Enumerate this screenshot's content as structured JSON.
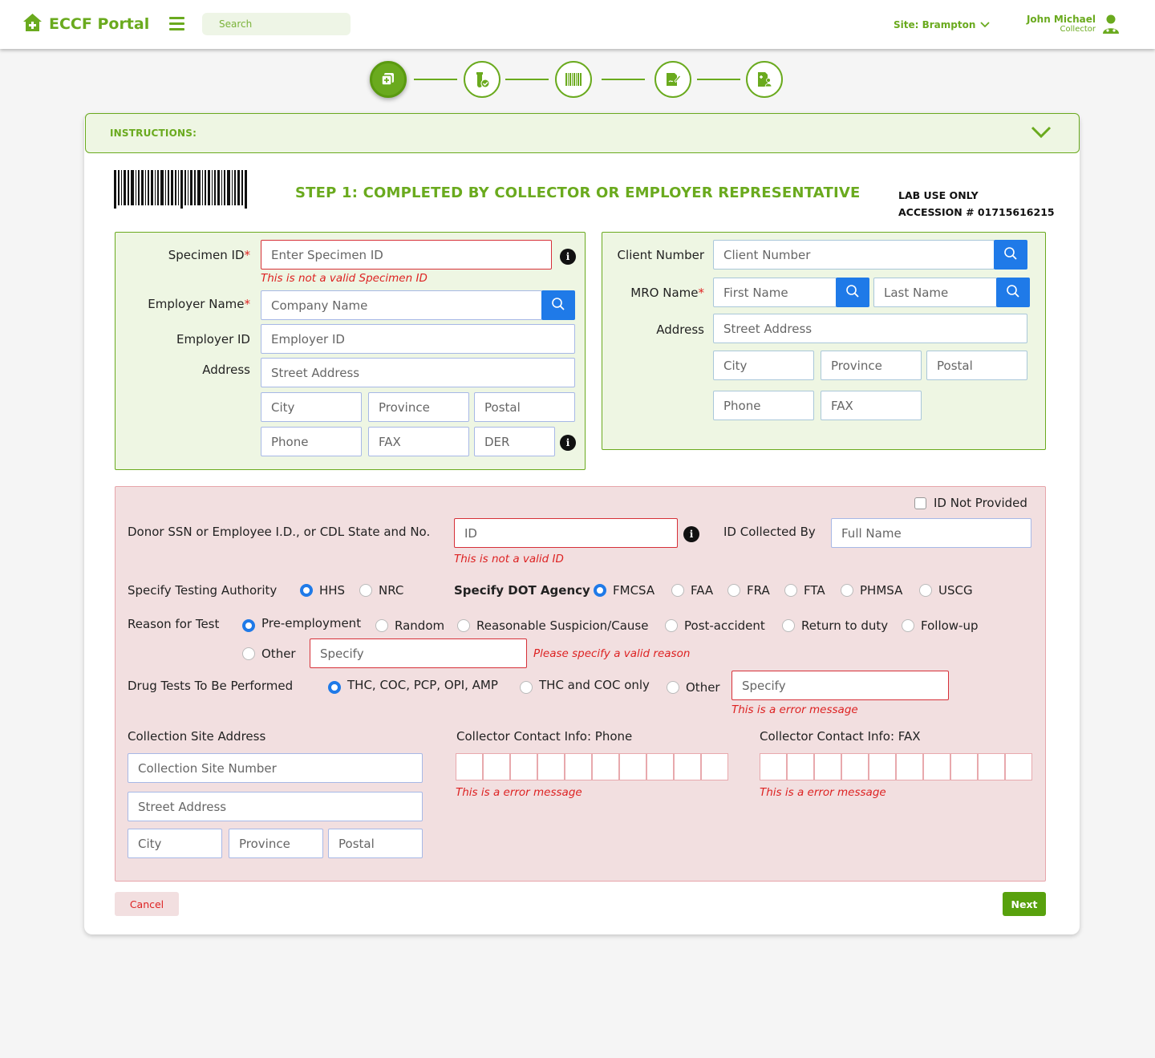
{
  "header": {
    "brand": "ECCF Portal",
    "search_placeholder": "Search",
    "site_label": "Site: Brampton",
    "user_name": "John Michael",
    "user_role": "Collector"
  },
  "stepper": {
    "steps": [
      {
        "icon": "document-add-icon",
        "active": true
      },
      {
        "icon": "specimen-check-icon",
        "active": false
      },
      {
        "icon": "barcode-icon",
        "active": false
      },
      {
        "icon": "signature-edit-icon",
        "active": false
      },
      {
        "icon": "id-card-icon",
        "active": false
      }
    ]
  },
  "instructions": {
    "label": "INSTRUCTIONS:"
  },
  "step_title": "STEP 1: COMPLETED BY COLLECTOR OR EMPLOYER REPRESENTATIVE",
  "lab": {
    "line1": "LAB USE ONLY",
    "line2": "ACCESSION # 01715616215"
  },
  "employer_panel": {
    "specimen_label": "Specimen ID",
    "specimen_placeholder": "Enter Specimen ID",
    "specimen_error": "This is not a valid Specimen ID",
    "employer_name_label": "Employer Name",
    "employer_name_placeholder": "Company Name",
    "employer_id_label": "Employer ID",
    "employer_id_placeholder": "Employer ID",
    "address_label": "Address",
    "street_placeholder": "Street Address",
    "city_placeholder": "City",
    "province_placeholder": "Province",
    "postal_placeholder": "Postal",
    "phone_placeholder": "Phone",
    "fax_placeholder": "FAX",
    "der_placeholder": "DER"
  },
  "mro_panel": {
    "client_label": "Client Number",
    "client_placeholder": "Client Number",
    "mro_label": "MRO Name",
    "first_placeholder": "First Name",
    "last_placeholder": "Last Name",
    "address_label": "Address",
    "street_placeholder": "Street Address",
    "city_placeholder": "City",
    "province_placeholder": "Province",
    "postal_placeholder": "Postal",
    "phone_placeholder": "Phone",
    "fax_placeholder": "FAX"
  },
  "donor_panel": {
    "id_not_provided": "ID Not Provided",
    "donor_label": "Donor SSN or Employee I.D., or CDL State and No.",
    "id_placeholder": "ID",
    "id_error": "This is not a valid  ID",
    "collected_by_label": "ID Collected By",
    "collected_by_placeholder": "Full Name",
    "authority_label": "Specify Testing Authority",
    "authority_options": [
      "HHS",
      "NRC"
    ],
    "authority_selected": "HHS",
    "dot_label": "Specify DOT Agency",
    "dot_options": [
      "FMCSA",
      "FAA",
      "FRA",
      "FTA",
      "PHMSA",
      "USCG"
    ],
    "dot_selected": "FMCSA",
    "reason_label": "Reason for Test",
    "reason_options": [
      "Pre-employment",
      "Random",
      "Reasonable Suspicion/Cause",
      "Post-accident",
      "Return to duty",
      "Follow-up",
      "Other"
    ],
    "reason_selected": "Pre-employment",
    "reason_specify_placeholder": "Specify",
    "reason_error": "Please specify a valid reason",
    "drug_label": "Drug Tests To Be Performed",
    "drug_options": [
      "THC, COC, PCP, OPI, AMP",
      "THC and COC only",
      "Other"
    ],
    "drug_selected": "THC, COC, PCP, OPI, AMP",
    "drug_specify_placeholder": "Specify",
    "drug_error": "This is a error message",
    "site_address_label": "Collection Site Address",
    "site_number_placeholder": "Collection Site Number",
    "site_street_placeholder": "Street Address",
    "site_city_placeholder": "City",
    "site_province_placeholder": "Province",
    "site_postal_placeholder": "Postal",
    "phone_label": "Collector Contact Info: Phone",
    "phone_error": "This is a error message",
    "fax_label": "Collector Contact Info: FAX",
    "fax_error": "This is a error message"
  },
  "actions": {
    "cancel": "Cancel",
    "next": "Next"
  },
  "colors": {
    "brand_green": "#6aaa1e",
    "primary_blue": "#1f7ae8",
    "error_red": "#d22",
    "panel_green": "#eef6e3",
    "panel_red": "#f2dfe0"
  }
}
